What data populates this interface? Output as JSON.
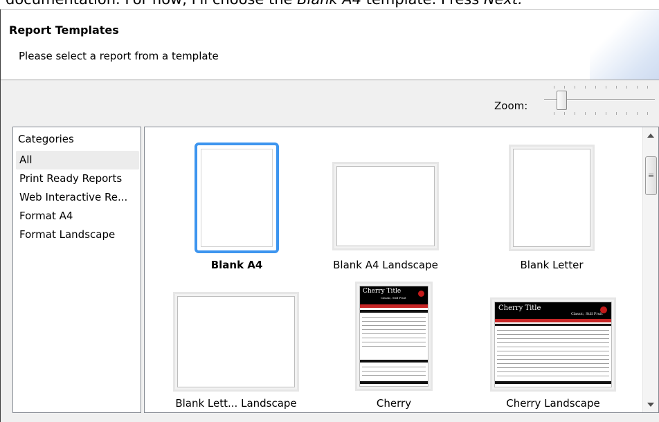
{
  "doc_text": {
    "prefix": "documentation. For now, I'll choose the ",
    "emphasis1": "Blank A4",
    "middle": " template. Press ",
    "emphasis2": "Next."
  },
  "header": {
    "title": "Report Templates",
    "subtitle": "Please select a report from a template"
  },
  "zoom": {
    "label": "Zoom:",
    "level": 0.12
  },
  "categories": {
    "header": "Categories",
    "selected": "All",
    "items": [
      {
        "label": "All"
      },
      {
        "label": "Print Ready Reports"
      },
      {
        "label": "Web Interactive Re..."
      },
      {
        "label": "Format A4"
      },
      {
        "label": "Format Landscape"
      }
    ]
  },
  "templates": [
    {
      "label": "Blank A4",
      "selected": true
    },
    {
      "label": "Blank A4 Landscape",
      "selected": false
    },
    {
      "label": "Blank Letter",
      "selected": false
    },
    {
      "label": "Blank Lett... Landscape",
      "selected": false
    },
    {
      "label": "Cherry",
      "selected": false
    },
    {
      "label": "Cherry Landscape",
      "selected": false
    }
  ],
  "cherry_thumb": {
    "title": "Cherry Title",
    "subtitle": "Classic, Still Fruit"
  },
  "colors": {
    "selection_border": "#3d95ef",
    "cherry_red": "#c72626",
    "list_selected_bg": "#ececec"
  }
}
